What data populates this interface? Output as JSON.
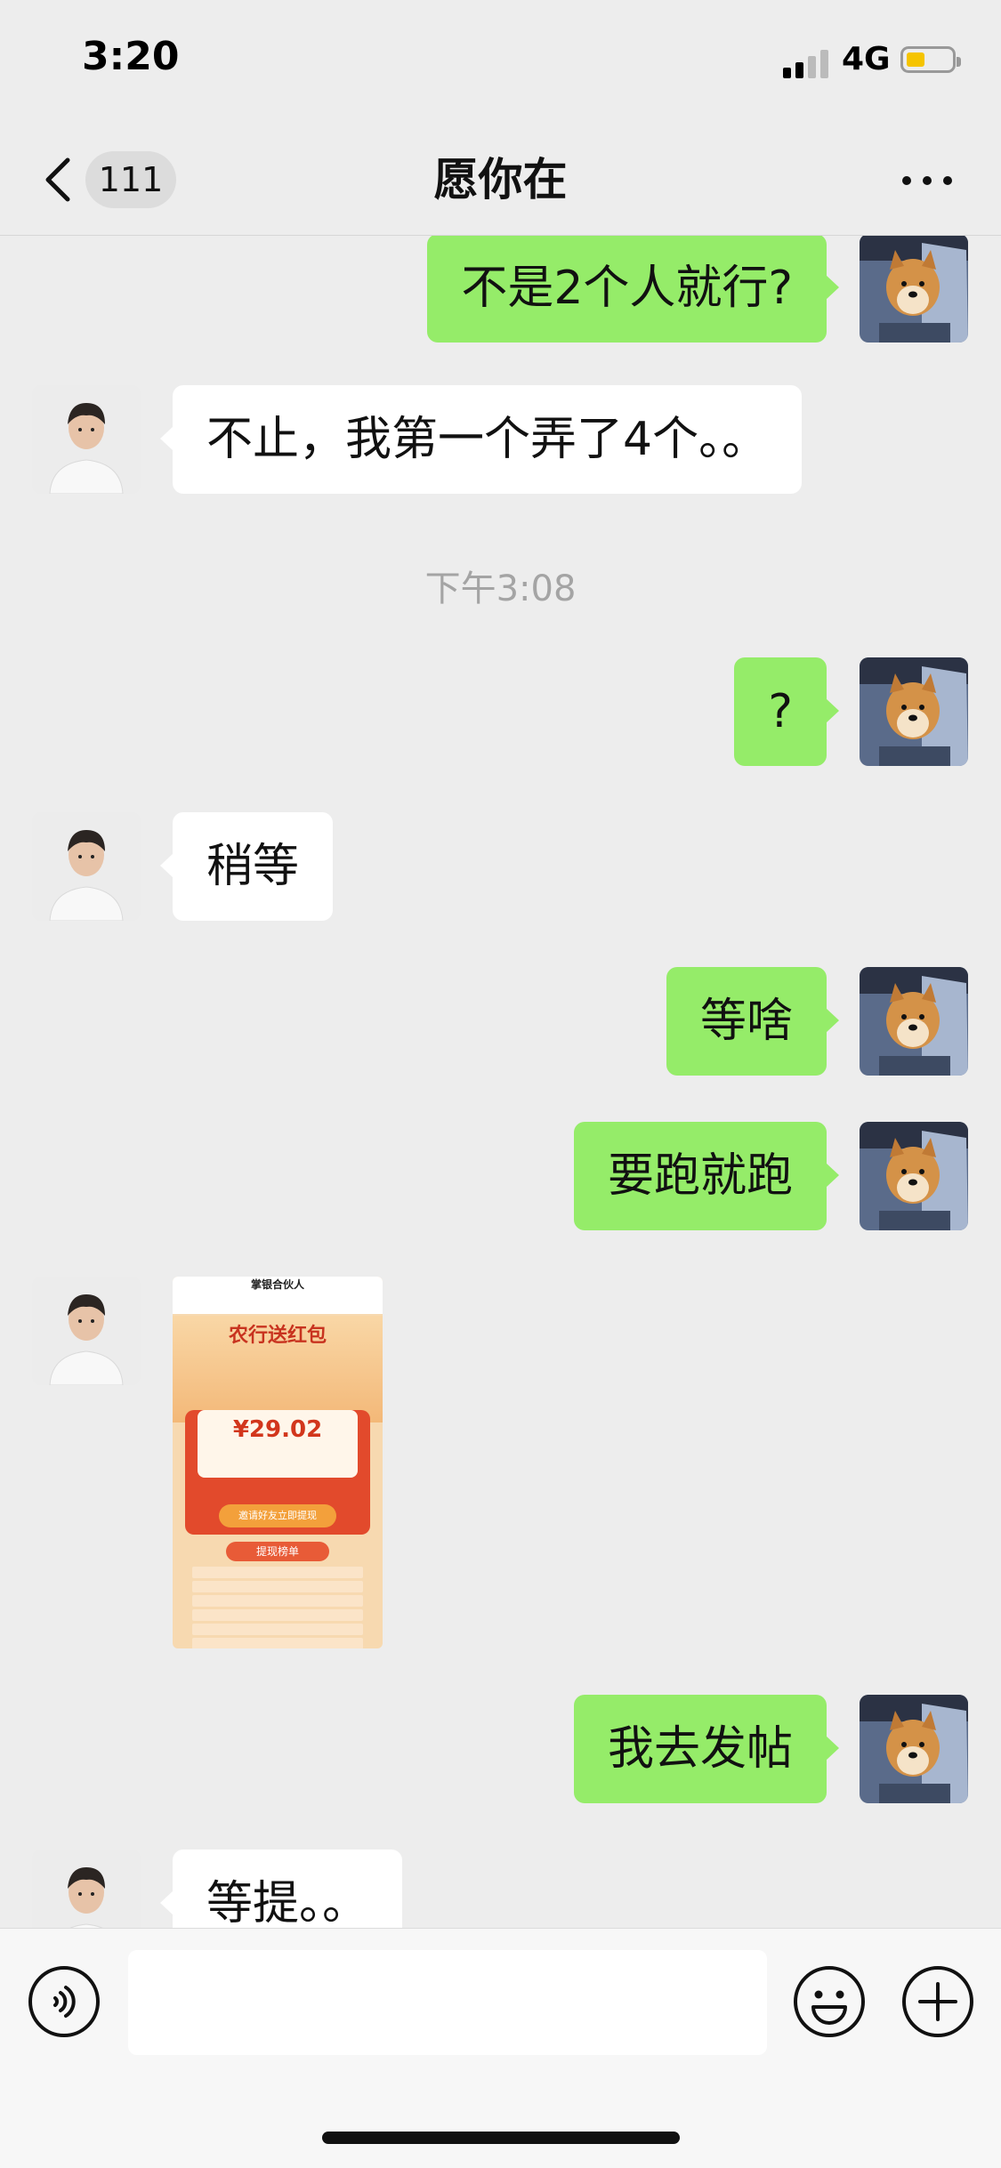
{
  "status_bar": {
    "time": "3:20",
    "network": "4G",
    "battery_color": "#f5c400"
  },
  "nav": {
    "unread_count": "111",
    "title": "愿你在"
  },
  "messages": [
    {
      "from": "me",
      "text": "不是2个人就行?"
    },
    {
      "from": "other",
      "text": "不止，我第一个弄了4个。。"
    },
    {
      "type": "timestamp",
      "text": "下午3:08"
    },
    {
      "from": "me",
      "text": "?"
    },
    {
      "from": "other",
      "text": "稍等"
    },
    {
      "from": "me",
      "text": "等啥"
    },
    {
      "from": "me",
      "text": "要跑就跑"
    },
    {
      "from": "other",
      "type": "image",
      "image": {
        "title": "掌银合伙人",
        "headline": "农行送红包",
        "amount": "¥29.02",
        "button": "邀请好友立即提现",
        "list_title": "提现榜单"
      }
    },
    {
      "from": "me",
      "text": "我去发帖"
    },
    {
      "from": "other",
      "text": "等提。。"
    }
  ],
  "colors": {
    "my_bubble": "#95ec69",
    "their_bubble": "#ffffff",
    "background": "#ededed"
  },
  "icons": [
    "back-arrow",
    "more-dots",
    "voice",
    "emoji",
    "plus"
  ]
}
